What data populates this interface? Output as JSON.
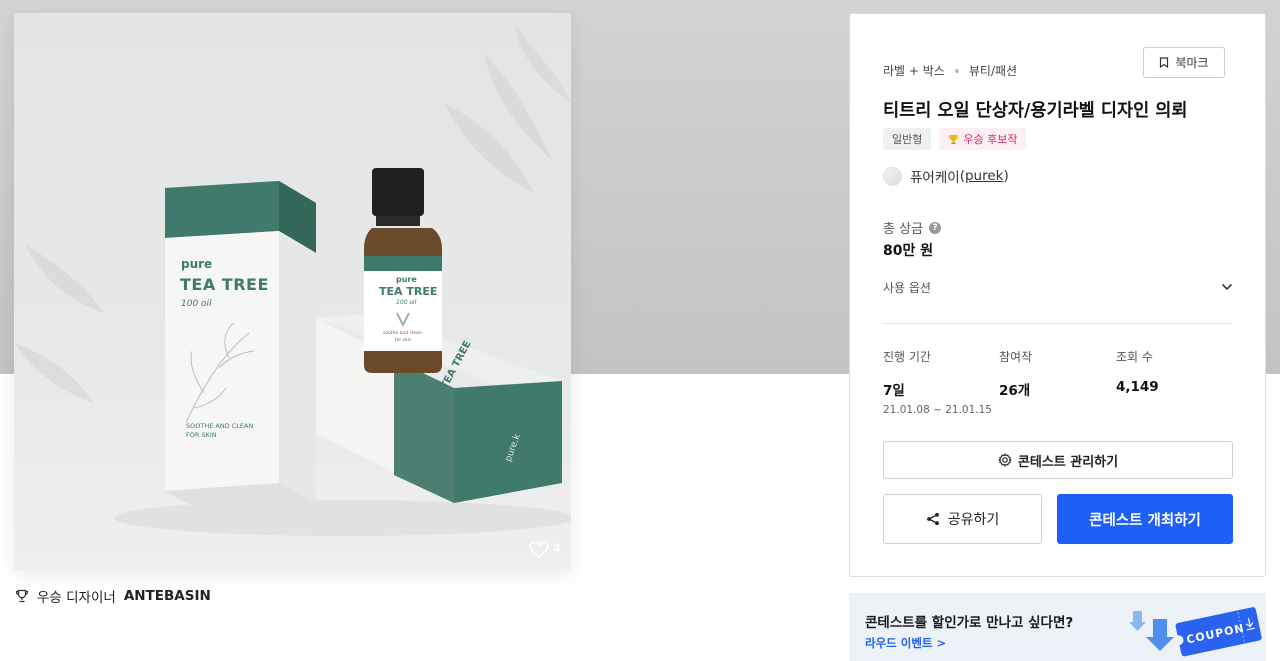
{
  "product_image": {
    "alt": "TEA TREE 100 oil packaging",
    "likes": "4",
    "packaging": {
      "brand": "pure",
      "product": "TEA TREE",
      "volume": "100 oil",
      "tagline_line1": "SOOTHE AND CLEAN",
      "tagline_line2": "FOR SKIN",
      "box_top_logo": "pure.k",
      "bottle_tagline_line1": "soothe and clean",
      "bottle_tagline_line2": "for skin",
      "side_logo": "pure.k"
    }
  },
  "winner": {
    "prefix": "우승 디자이너",
    "name": "ANTEBASIN"
  },
  "card": {
    "category_1": "라벨 + 박스",
    "category_2": "뷰티/패션",
    "bookmark_label": "북마크",
    "title": "티트리 오일 단상자/용기라벨 디자인 의뢰",
    "tag_general": "일반형",
    "tag_award": "우승 후보작",
    "host_name": "퓨어케이",
    "host_handle": "purek",
    "prize_label": "총 상금",
    "prize_value": "80만 원",
    "options_label": "사용 옵션",
    "stats": [
      {
        "label": "진행 기간",
        "value": "7일",
        "sub": "21.01.08 ~ 21.01.15"
      },
      {
        "label": "참여작",
        "value": "26개"
      },
      {
        "label": "조회 수",
        "value": "4,149"
      }
    ],
    "manage_label": "콘테스트 관리하기",
    "share_label": "공유하기",
    "open_label": "콘테스트 개최하기"
  },
  "banner": {
    "headline": "콘테스트를 할인가로 만나고 싶다면?",
    "link": "라우드 이벤트 >",
    "coupon_text": "COUPON"
  },
  "colors": {
    "accent": "#1f5ff5",
    "box_green": "#3f7a6c",
    "award_text": "#e0245e"
  }
}
